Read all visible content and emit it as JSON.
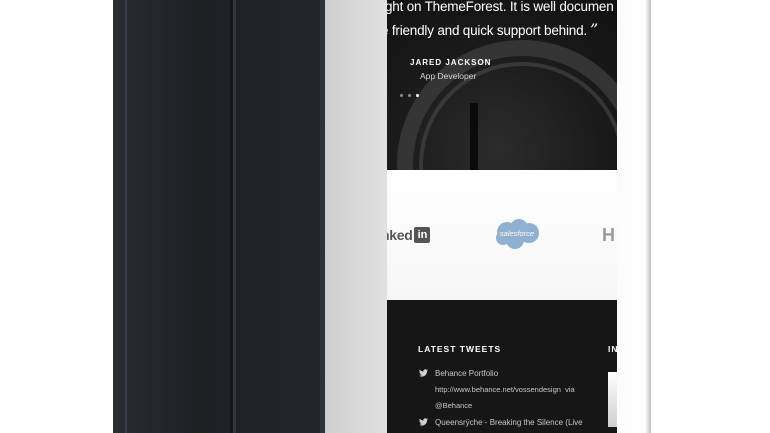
{
  "testimonial": {
    "quote_line_1": "ght on ThemeForest. It is well documen",
    "quote_line_2": "e friendly and quick support behind.",
    "quote_mark": "”",
    "author_name": "JARED JACKSON",
    "author_role": "App Developer",
    "slider_dots": 3,
    "active_dot": 2
  },
  "clients": {
    "linkedin_text": "nked",
    "linkedin_in": "in",
    "salesforce": "salesforce",
    "hp": "H"
  },
  "footer": {
    "tweets_heading": "LATEST TWEETS",
    "second_heading": "IN",
    "tweets": [
      {
        "title": "Behance Portfolio",
        "url": "http://www.behance.net/vossendesign",
        "via_label": "via",
        "handle": "@Behance"
      },
      {
        "title": "Queensrÿche - Breaking the Silence (Live"
      }
    ]
  },
  "colors": {
    "cover": "#23252a",
    "screen_bg": "#141414",
    "salesforce_blue": "#8fb0d1"
  },
  "icons": {
    "tweet_icon": "twitter-bird-icon"
  }
}
